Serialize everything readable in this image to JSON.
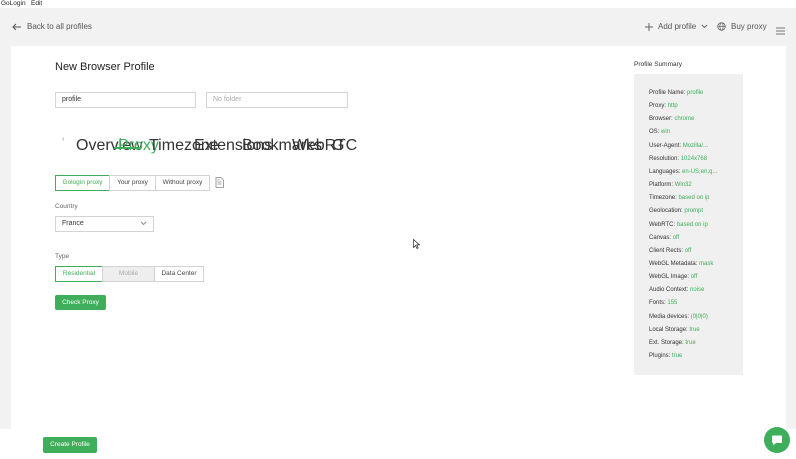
{
  "menubar": {
    "app": "GoLogin",
    "edit": "Edit"
  },
  "topbar": {
    "back_label": "Back to all profiles",
    "add_profile_label": "Add profile",
    "buy_proxy_label": "Buy proxy"
  },
  "page": {
    "title": "New Browser Profile",
    "name_value": "profile",
    "folder_placeholder": "No folder"
  },
  "tabs": [
    {
      "label": "Overview"
    },
    {
      "label": "Proxy"
    },
    {
      "label": "Timezone"
    },
    {
      "label": "Extensions"
    },
    {
      "label": "Bookmarks"
    },
    {
      "label": "WebRTC"
    },
    {
      "label": "G"
    }
  ],
  "active_tab": "Proxy",
  "proxy_modes": [
    "Gologin proxy",
    "Your proxy",
    "Without proxy"
  ],
  "country": {
    "label": "Country",
    "value": "France"
  },
  "type": {
    "label": "Type",
    "options": [
      "Residential",
      "Mobile",
      "Data Center"
    ]
  },
  "check_proxy_label": "Check Proxy",
  "summary": {
    "title": "Profile Summary",
    "rows": [
      {
        "k": "Profile Name:",
        "v": "profile"
      },
      {
        "k": "Proxy:",
        "v": "http"
      },
      {
        "k": "Browser:",
        "v": "chrome"
      },
      {
        "k": "OS:",
        "v": "win"
      },
      {
        "k": "User-Agent:",
        "v": "Mozilla/..."
      },
      {
        "k": "Resolution:",
        "v": "1024x768"
      },
      {
        "k": "Languages:",
        "v": "en-US,en;q..."
      },
      {
        "k": "Platform:",
        "v": "Win32"
      },
      {
        "k": "Timezone:",
        "v": "based on ip"
      },
      {
        "k": "Geolocation:",
        "v": "prompt"
      },
      {
        "k": "WebRTC:",
        "v": "based on ip"
      },
      {
        "k": "Canvas:",
        "v": "off"
      },
      {
        "k": "Client Rects:",
        "v": "off"
      },
      {
        "k": "WebGL Metadata:",
        "v": "mask"
      },
      {
        "k": "WebGL Image:",
        "v": "off"
      },
      {
        "k": "Audio Context:",
        "v": "noise"
      },
      {
        "k": "Fonts:",
        "v": "155"
      },
      {
        "k": "Media devices:",
        "v": "(0|0|0)"
      },
      {
        "k": "Local Storage:",
        "v": "true"
      },
      {
        "k": "Ext. Storage:",
        "v": "true"
      },
      {
        "k": "Plugins:",
        "v": "true"
      }
    ]
  },
  "create_profile_label": "Create Profile",
  "colors": {
    "accent": "#3fae5a"
  }
}
